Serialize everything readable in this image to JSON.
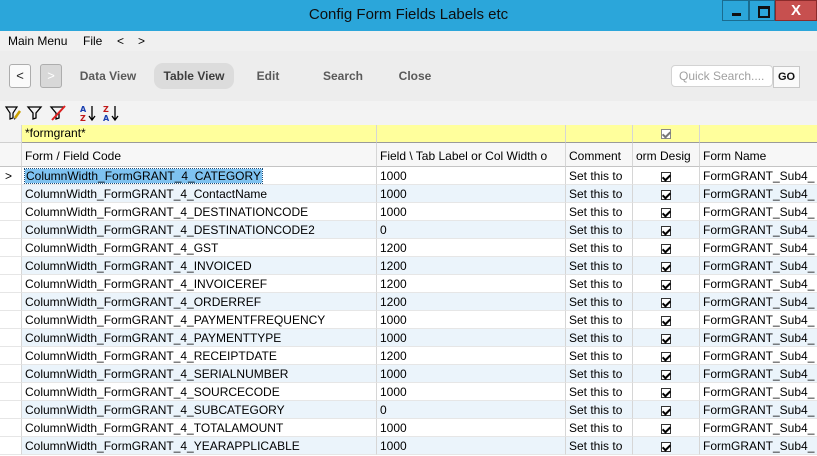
{
  "window": {
    "title": "Config Form Fields Labels etc",
    "close_glyph": "X"
  },
  "menu": {
    "items": [
      "Main Menu",
      "File",
      "<",
      ">"
    ]
  },
  "toolbar": {
    "back": "<",
    "forward": ">",
    "data_view": "Data View",
    "table_view": "Table View",
    "edit": "Edit",
    "search": "Search",
    "close": "Close",
    "quick_search_placeholder": "Quick Search....",
    "go": "GO"
  },
  "icons": [
    "filter-edit-icon",
    "filter-icon",
    "filter-clear-icon",
    "sort-az-icon",
    "sort-za-icon"
  ],
  "grid": {
    "filter": {
      "code": "*formgrant*"
    },
    "columns": [
      "Form / Field Code",
      "Field \\ Tab Label or Col Width o",
      "Comment",
      "orm Desig",
      "Form Name"
    ],
    "selected_row": 0,
    "row_indicator": ">",
    "rows": [
      {
        "code": "ColumnWidth_FormGRANT_4_CATEGORY",
        "value": "1000",
        "comment": "Set this to",
        "form": "FormGRANT_Sub4_"
      },
      {
        "code": "ColumnWidth_FormGRANT_4_ContactName",
        "value": "1000",
        "comment": "Set this to",
        "form": "FormGRANT_Sub4_"
      },
      {
        "code": "ColumnWidth_FormGRANT_4_DESTINATIONCODE",
        "value": "1000",
        "comment": "Set this to",
        "form": "FormGRANT_Sub4_"
      },
      {
        "code": "ColumnWidth_FormGRANT_4_DESTINATIONCODE2",
        "value": "0",
        "comment": "Set this to",
        "form": "FormGRANT_Sub4_"
      },
      {
        "code": "ColumnWidth_FormGRANT_4_GST",
        "value": "1200",
        "comment": "Set this to",
        "form": "FormGRANT_Sub4_"
      },
      {
        "code": "ColumnWidth_FormGRANT_4_INVOICED",
        "value": "1200",
        "comment": "Set this to",
        "form": "FormGRANT_Sub4_"
      },
      {
        "code": "ColumnWidth_FormGRANT_4_INVOICEREF",
        "value": "1200",
        "comment": "Set this to",
        "form": "FormGRANT_Sub4_"
      },
      {
        "code": "ColumnWidth_FormGRANT_4_ORDERREF",
        "value": "1200",
        "comment": "Set this to",
        "form": "FormGRANT_Sub4_"
      },
      {
        "code": "ColumnWidth_FormGRANT_4_PAYMENTFREQUENCY",
        "value": "1000",
        "comment": "Set this to",
        "form": "FormGRANT_Sub4_"
      },
      {
        "code": "ColumnWidth_FormGRANT_4_PAYMENTTYPE",
        "value": "1000",
        "comment": "Set this to",
        "form": "FormGRANT_Sub4_"
      },
      {
        "code": "ColumnWidth_FormGRANT_4_RECEIPTDATE",
        "value": "1200",
        "comment": "Set this to",
        "form": "FormGRANT_Sub4_"
      },
      {
        "code": "ColumnWidth_FormGRANT_4_SERIALNUMBER",
        "value": "1000",
        "comment": "Set this to",
        "form": "FormGRANT_Sub4_"
      },
      {
        "code": "ColumnWidth_FormGRANT_4_SOURCECODE",
        "value": "1000",
        "comment": "Set this to",
        "form": "FormGRANT_Sub4_"
      },
      {
        "code": "ColumnWidth_FormGRANT_4_SUBCATEGORY",
        "value": "0",
        "comment": "Set this to",
        "form": "FormGRANT_Sub4_"
      },
      {
        "code": "ColumnWidth_FormGRANT_4_TOTALAMOUNT",
        "value": "1000",
        "comment": "Set this to",
        "form": "FormGRANT_Sub4_"
      },
      {
        "code": "ColumnWidth_FormGRANT_4_YEARAPPLICABLE",
        "value": "1000",
        "comment": "Set this to",
        "form": "FormGRANT_Sub4_"
      }
    ]
  }
}
